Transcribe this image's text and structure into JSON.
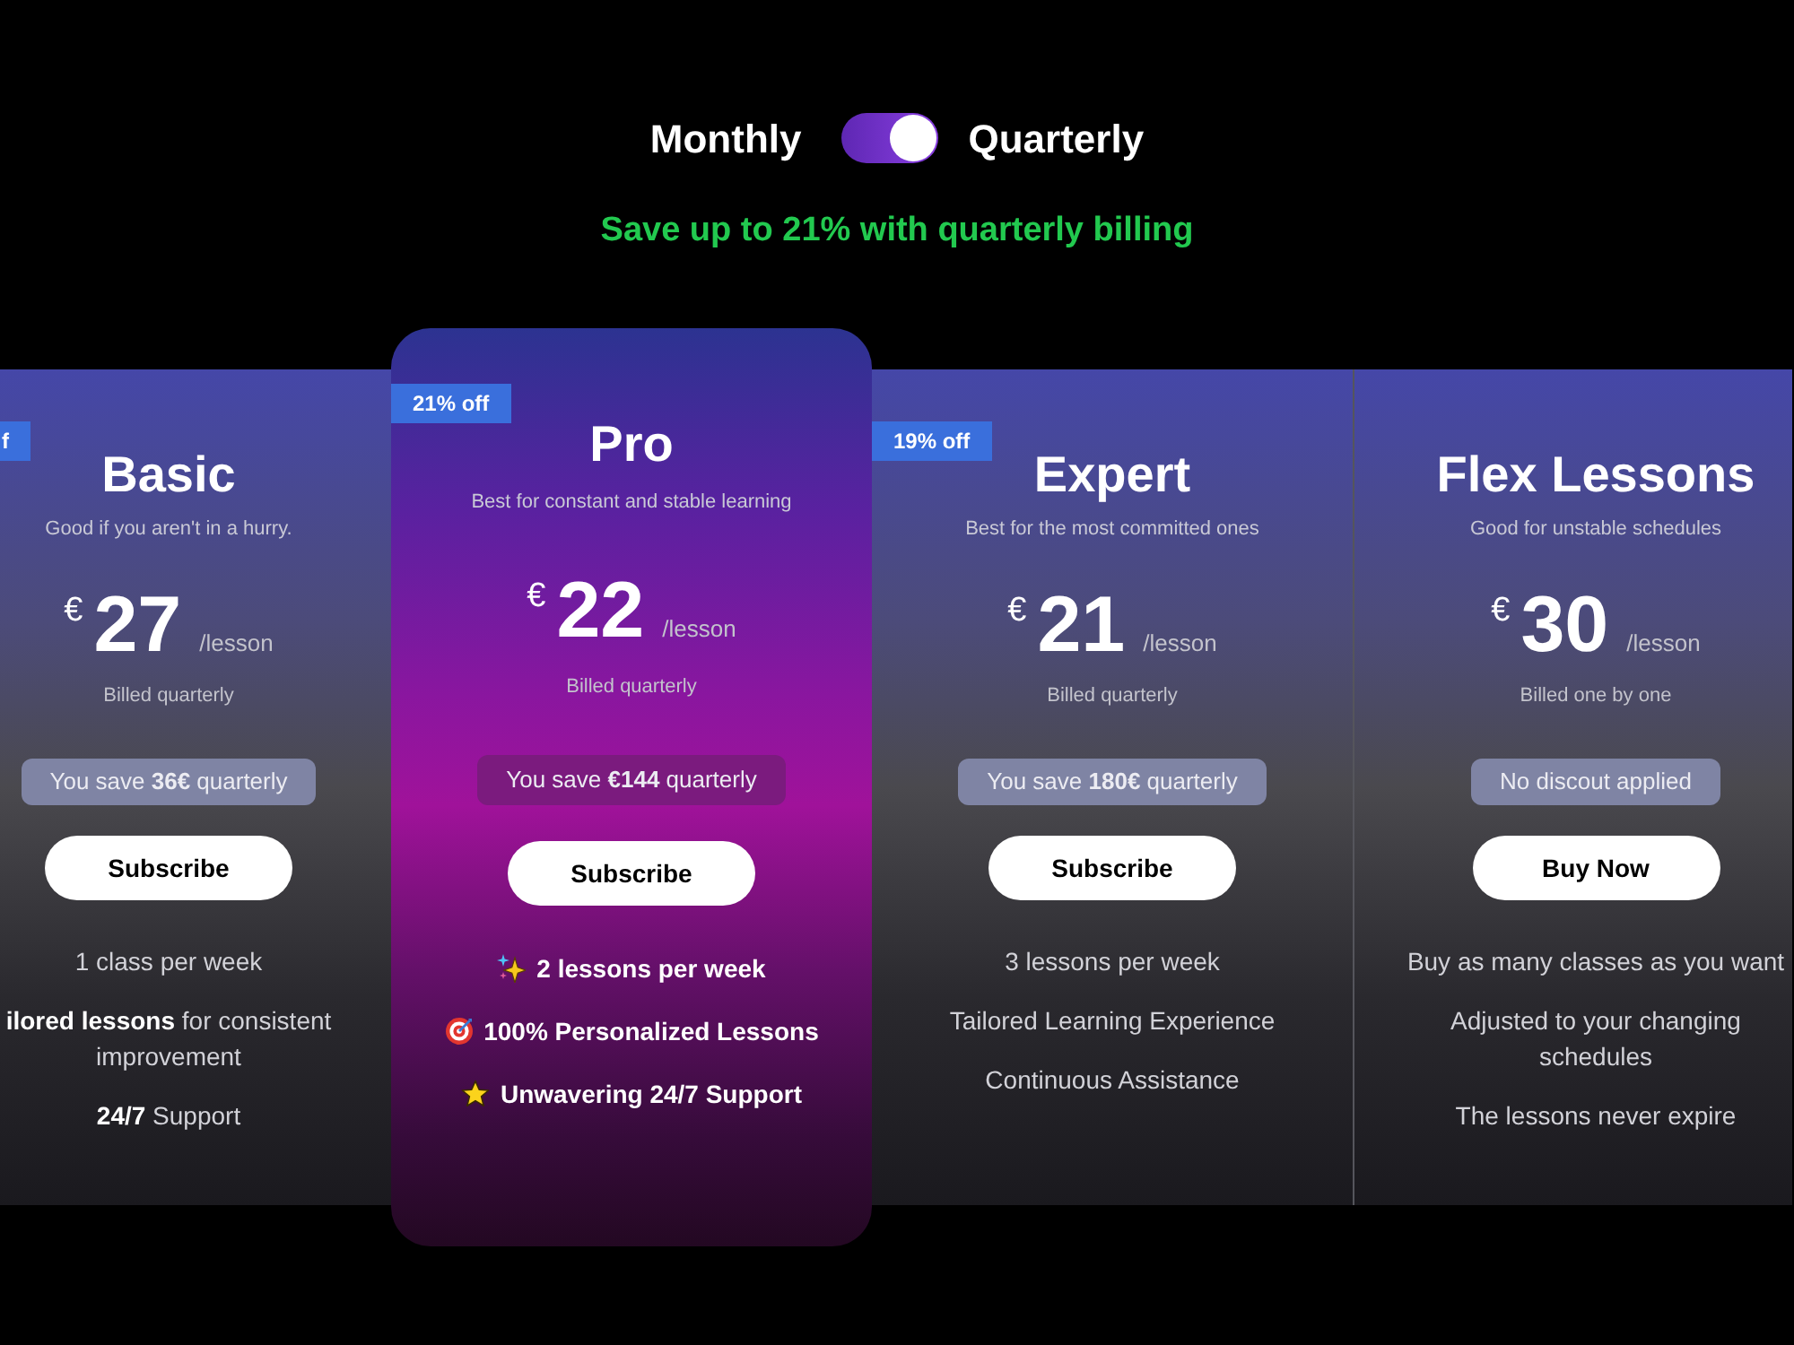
{
  "billing_toggle": {
    "left_label": "Monthly",
    "right_label": "Quarterly",
    "on": true
  },
  "savings_note": "Save up to 21% with quarterly billing",
  "plans": [
    {
      "badge": "f",
      "name": "Basic",
      "tagline": "Good if you aren't in a hurry.",
      "currency": "€",
      "price": "27",
      "unit": "/lesson",
      "billing": "Billed quarterly",
      "savings": "You save **36€** quarterly",
      "button": "Subscribe",
      "featured": false,
      "features": [
        "1 class per week",
        "**ilored lessons** for consistent improvement",
        "**24/7** Support"
      ]
    },
    {
      "badge": "21% off",
      "name": "Pro",
      "tagline": "Best for constant and stable learning",
      "currency": "€",
      "price": "22",
      "unit": "/lesson",
      "billing": "Billed quarterly",
      "savings": "You save **€144** quarterly",
      "button": "Subscribe",
      "featured": true,
      "features": [
        "2 lessons per week",
        "100% Personalized Lessons",
        "Unwavering 24/7 Support"
      ]
    },
    {
      "badge": "19% off",
      "name": "Expert",
      "tagline": "Best for the most committed ones",
      "currency": "€",
      "price": "21",
      "unit": "/lesson",
      "billing": "Billed quarterly",
      "savings": "You save **180€** quarterly",
      "button": "Subscribe",
      "featured": false,
      "features": [
        "3 lessons per week",
        "Tailored Learning Experience",
        "Continuous Assistance"
      ]
    },
    {
      "name": "Flex Lessons",
      "tagline": "Good for unstable schedules",
      "currency": "€",
      "price": "30",
      "unit": "/lesson",
      "billing": "Billed one by one",
      "savings": "No discout applied",
      "button": "Buy Now",
      "featured": false,
      "features": [
        "Buy as many classes as you want",
        "Adjusted to your changing schedules",
        "The lessons never expire"
      ]
    }
  ]
}
